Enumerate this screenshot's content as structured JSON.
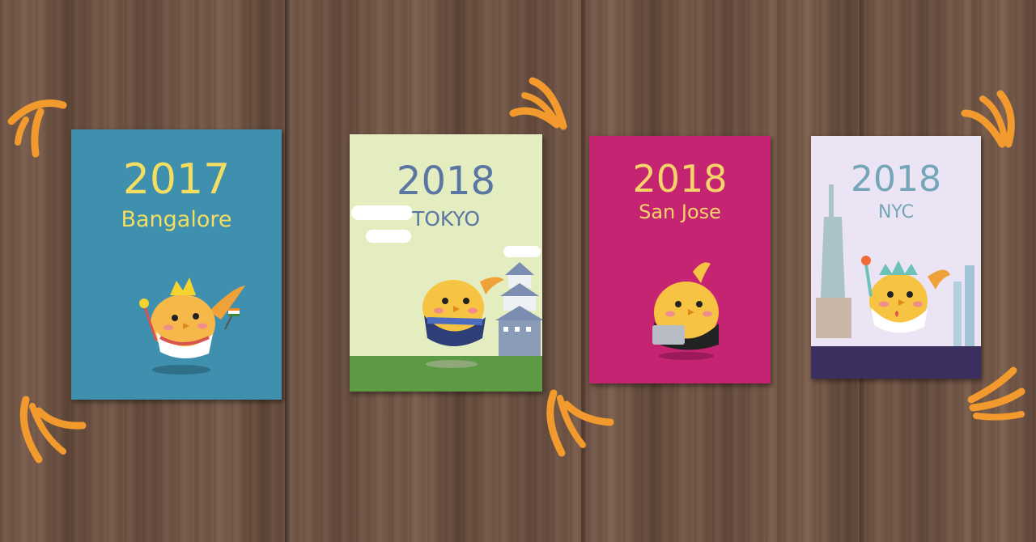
{
  "posters": [
    {
      "year": "2017",
      "city": "Bangalore",
      "bg": "#3f8fae",
      "text_color": "#f3de62"
    },
    {
      "year": "2018",
      "city": "TOKYO",
      "bg": "#e4edc0",
      "text_color": "#5a77a4"
    },
    {
      "year": "2018",
      "city": "San Jose",
      "bg": "#c52472",
      "text_color": "#f7d46a"
    },
    {
      "year": "2018",
      "city": "NYC",
      "bg": "#ebe4f4",
      "text_color": "#74a6b8"
    }
  ],
  "colors": {
    "wall": "#6f5344",
    "claw": "#f29a2e",
    "mascot_yellow": "#f7c343",
    "tokyo_grass": "#5c9a45",
    "nyc_band": "#3b2f60"
  },
  "icons": [
    "bird-mascot-icon",
    "claw-mark-icon"
  ]
}
